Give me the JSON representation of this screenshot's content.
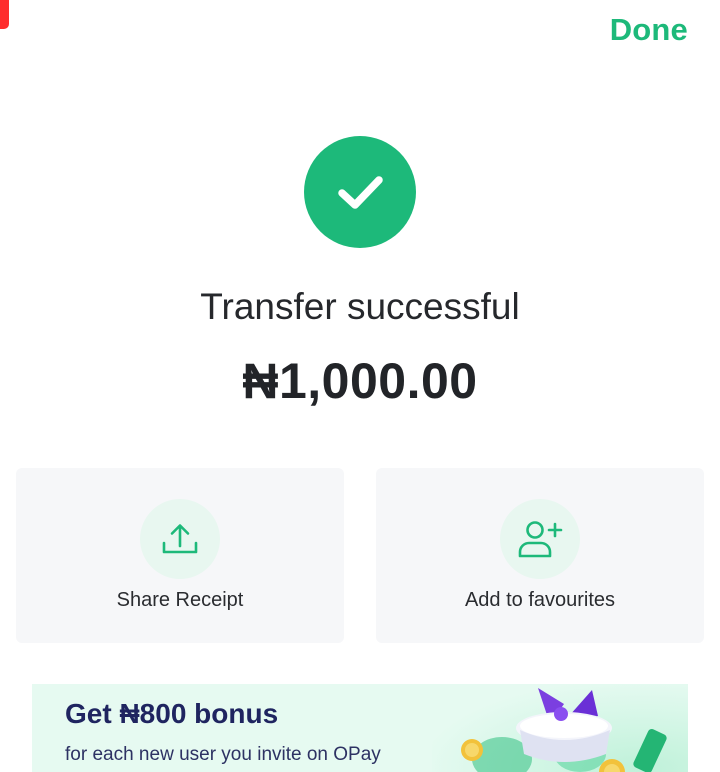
{
  "header": {
    "done_label": "Done"
  },
  "status": {
    "icon": "check-circle-icon",
    "title": "Transfer successful",
    "amount": "₦1,000.00"
  },
  "actions": [
    {
      "label": "Share Receipt",
      "icon": "share-upload-icon"
    },
    {
      "label": "Add to favourites",
      "icon": "add-user-icon"
    }
  ],
  "promo": {
    "title": "Get ₦800 bonus",
    "subtitle": "for each new user you invite on OPay"
  },
  "colors": {
    "accent": "#1db97a",
    "promo_title": "#1f2560",
    "card_background": "#f6f7f9",
    "marker": "#ff2d2d"
  }
}
